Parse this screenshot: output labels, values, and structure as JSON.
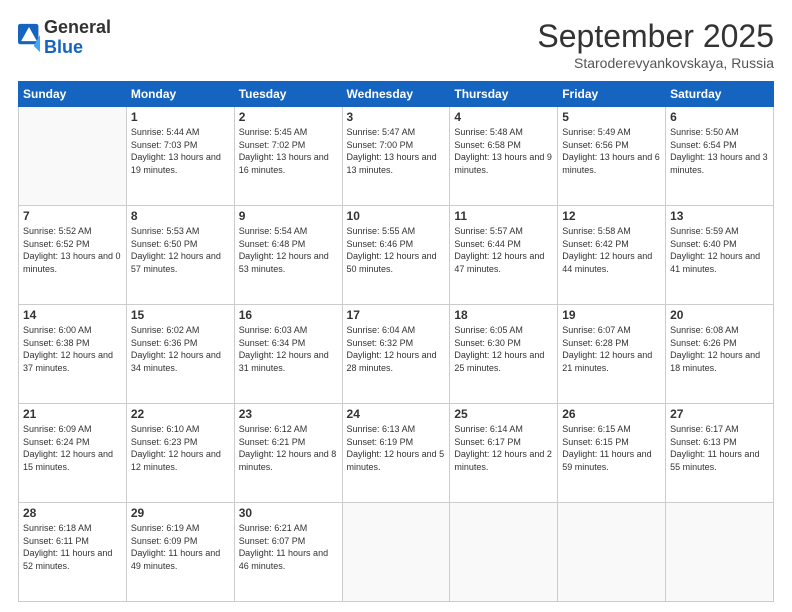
{
  "header": {
    "logo": {
      "line1": "General",
      "line2": "Blue"
    },
    "title": "September 2025",
    "location": "Staroderevyankovskaya, Russia"
  },
  "weekdays": [
    "Sunday",
    "Monday",
    "Tuesday",
    "Wednesday",
    "Thursday",
    "Friday",
    "Saturday"
  ],
  "weeks": [
    [
      {
        "day": "",
        "sunrise": "",
        "sunset": "",
        "daylight": ""
      },
      {
        "day": "1",
        "sunrise": "Sunrise: 5:44 AM",
        "sunset": "Sunset: 7:03 PM",
        "daylight": "Daylight: 13 hours and 19 minutes."
      },
      {
        "day": "2",
        "sunrise": "Sunrise: 5:45 AM",
        "sunset": "Sunset: 7:02 PM",
        "daylight": "Daylight: 13 hours and 16 minutes."
      },
      {
        "day": "3",
        "sunrise": "Sunrise: 5:47 AM",
        "sunset": "Sunset: 7:00 PM",
        "daylight": "Daylight: 13 hours and 13 minutes."
      },
      {
        "day": "4",
        "sunrise": "Sunrise: 5:48 AM",
        "sunset": "Sunset: 6:58 PM",
        "daylight": "Daylight: 13 hours and 9 minutes."
      },
      {
        "day": "5",
        "sunrise": "Sunrise: 5:49 AM",
        "sunset": "Sunset: 6:56 PM",
        "daylight": "Daylight: 13 hours and 6 minutes."
      },
      {
        "day": "6",
        "sunrise": "Sunrise: 5:50 AM",
        "sunset": "Sunset: 6:54 PM",
        "daylight": "Daylight: 13 hours and 3 minutes."
      }
    ],
    [
      {
        "day": "7",
        "sunrise": "Sunrise: 5:52 AM",
        "sunset": "Sunset: 6:52 PM",
        "daylight": "Daylight: 13 hours and 0 minutes."
      },
      {
        "day": "8",
        "sunrise": "Sunrise: 5:53 AM",
        "sunset": "Sunset: 6:50 PM",
        "daylight": "Daylight: 12 hours and 57 minutes."
      },
      {
        "day": "9",
        "sunrise": "Sunrise: 5:54 AM",
        "sunset": "Sunset: 6:48 PM",
        "daylight": "Daylight: 12 hours and 53 minutes."
      },
      {
        "day": "10",
        "sunrise": "Sunrise: 5:55 AM",
        "sunset": "Sunset: 6:46 PM",
        "daylight": "Daylight: 12 hours and 50 minutes."
      },
      {
        "day": "11",
        "sunrise": "Sunrise: 5:57 AM",
        "sunset": "Sunset: 6:44 PM",
        "daylight": "Daylight: 12 hours and 47 minutes."
      },
      {
        "day": "12",
        "sunrise": "Sunrise: 5:58 AM",
        "sunset": "Sunset: 6:42 PM",
        "daylight": "Daylight: 12 hours and 44 minutes."
      },
      {
        "day": "13",
        "sunrise": "Sunrise: 5:59 AM",
        "sunset": "Sunset: 6:40 PM",
        "daylight": "Daylight: 12 hours and 41 minutes."
      }
    ],
    [
      {
        "day": "14",
        "sunrise": "Sunrise: 6:00 AM",
        "sunset": "Sunset: 6:38 PM",
        "daylight": "Daylight: 12 hours and 37 minutes."
      },
      {
        "day": "15",
        "sunrise": "Sunrise: 6:02 AM",
        "sunset": "Sunset: 6:36 PM",
        "daylight": "Daylight: 12 hours and 34 minutes."
      },
      {
        "day": "16",
        "sunrise": "Sunrise: 6:03 AM",
        "sunset": "Sunset: 6:34 PM",
        "daylight": "Daylight: 12 hours and 31 minutes."
      },
      {
        "day": "17",
        "sunrise": "Sunrise: 6:04 AM",
        "sunset": "Sunset: 6:32 PM",
        "daylight": "Daylight: 12 hours and 28 minutes."
      },
      {
        "day": "18",
        "sunrise": "Sunrise: 6:05 AM",
        "sunset": "Sunset: 6:30 PM",
        "daylight": "Daylight: 12 hours and 25 minutes."
      },
      {
        "day": "19",
        "sunrise": "Sunrise: 6:07 AM",
        "sunset": "Sunset: 6:28 PM",
        "daylight": "Daylight: 12 hours and 21 minutes."
      },
      {
        "day": "20",
        "sunrise": "Sunrise: 6:08 AM",
        "sunset": "Sunset: 6:26 PM",
        "daylight": "Daylight: 12 hours and 18 minutes."
      }
    ],
    [
      {
        "day": "21",
        "sunrise": "Sunrise: 6:09 AM",
        "sunset": "Sunset: 6:24 PM",
        "daylight": "Daylight: 12 hours and 15 minutes."
      },
      {
        "day": "22",
        "sunrise": "Sunrise: 6:10 AM",
        "sunset": "Sunset: 6:23 PM",
        "daylight": "Daylight: 12 hours and 12 minutes."
      },
      {
        "day": "23",
        "sunrise": "Sunrise: 6:12 AM",
        "sunset": "Sunset: 6:21 PM",
        "daylight": "Daylight: 12 hours and 8 minutes."
      },
      {
        "day": "24",
        "sunrise": "Sunrise: 6:13 AM",
        "sunset": "Sunset: 6:19 PM",
        "daylight": "Daylight: 12 hours and 5 minutes."
      },
      {
        "day": "25",
        "sunrise": "Sunrise: 6:14 AM",
        "sunset": "Sunset: 6:17 PM",
        "daylight": "Daylight: 12 hours and 2 minutes."
      },
      {
        "day": "26",
        "sunrise": "Sunrise: 6:15 AM",
        "sunset": "Sunset: 6:15 PM",
        "daylight": "Daylight: 11 hours and 59 minutes."
      },
      {
        "day": "27",
        "sunrise": "Sunrise: 6:17 AM",
        "sunset": "Sunset: 6:13 PM",
        "daylight": "Daylight: 11 hours and 55 minutes."
      }
    ],
    [
      {
        "day": "28",
        "sunrise": "Sunrise: 6:18 AM",
        "sunset": "Sunset: 6:11 PM",
        "daylight": "Daylight: 11 hours and 52 minutes."
      },
      {
        "day": "29",
        "sunrise": "Sunrise: 6:19 AM",
        "sunset": "Sunset: 6:09 PM",
        "daylight": "Daylight: 11 hours and 49 minutes."
      },
      {
        "day": "30",
        "sunrise": "Sunrise: 6:21 AM",
        "sunset": "Sunset: 6:07 PM",
        "daylight": "Daylight: 11 hours and 46 minutes."
      },
      {
        "day": "",
        "sunrise": "",
        "sunset": "",
        "daylight": ""
      },
      {
        "day": "",
        "sunrise": "",
        "sunset": "",
        "daylight": ""
      },
      {
        "day": "",
        "sunrise": "",
        "sunset": "",
        "daylight": ""
      },
      {
        "day": "",
        "sunrise": "",
        "sunset": "",
        "daylight": ""
      }
    ]
  ]
}
